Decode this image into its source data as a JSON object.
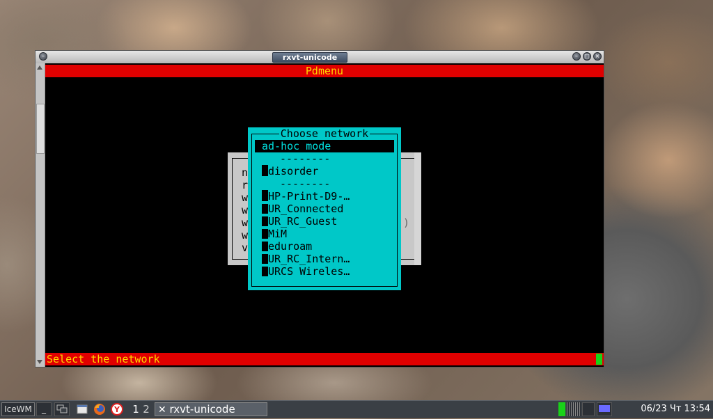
{
  "window": {
    "title": "rxvt-unicode",
    "menu_button": "–",
    "btn_minimize": "–",
    "btn_maximize": "□",
    "btn_close": "×"
  },
  "terminal": {
    "header": "Pdmenu",
    "status": "Select the network",
    "background_dialog": {
      "visible_letters": [
        "n",
        "r",
        "w",
        "w",
        "w",
        "w",
        "v"
      ],
      "paren": ")"
    },
    "menu": {
      "title": "Choose network",
      "items": [
        {
          "label": "ad-hoc mode",
          "selected": true
        },
        {
          "label": "--------",
          "separator": true
        },
        {
          "label": "disorder"
        },
        {
          "label": "--------",
          "separator": true
        },
        {
          "label": "HP-Print-D9-…"
        },
        {
          "label": "UR_Connected"
        },
        {
          "label": "UR_RC_Guest"
        },
        {
          "label": "MiM"
        },
        {
          "label": "eduroam"
        },
        {
          "label": "UR_RC_Intern…"
        },
        {
          "label": "URCS Wireles…"
        }
      ]
    }
  },
  "taskbar": {
    "start_label": "IceWM",
    "show_desktop": "_",
    "workspace_1": "1",
    "workspace_2": "2",
    "task_label": "rxvt-unicode",
    "task_icon": "x-icon",
    "clock": "06/23 Чт 13:54",
    "colors": {
      "cpu_green": "#19d219",
      "net_blue": "#6a6aff"
    }
  }
}
